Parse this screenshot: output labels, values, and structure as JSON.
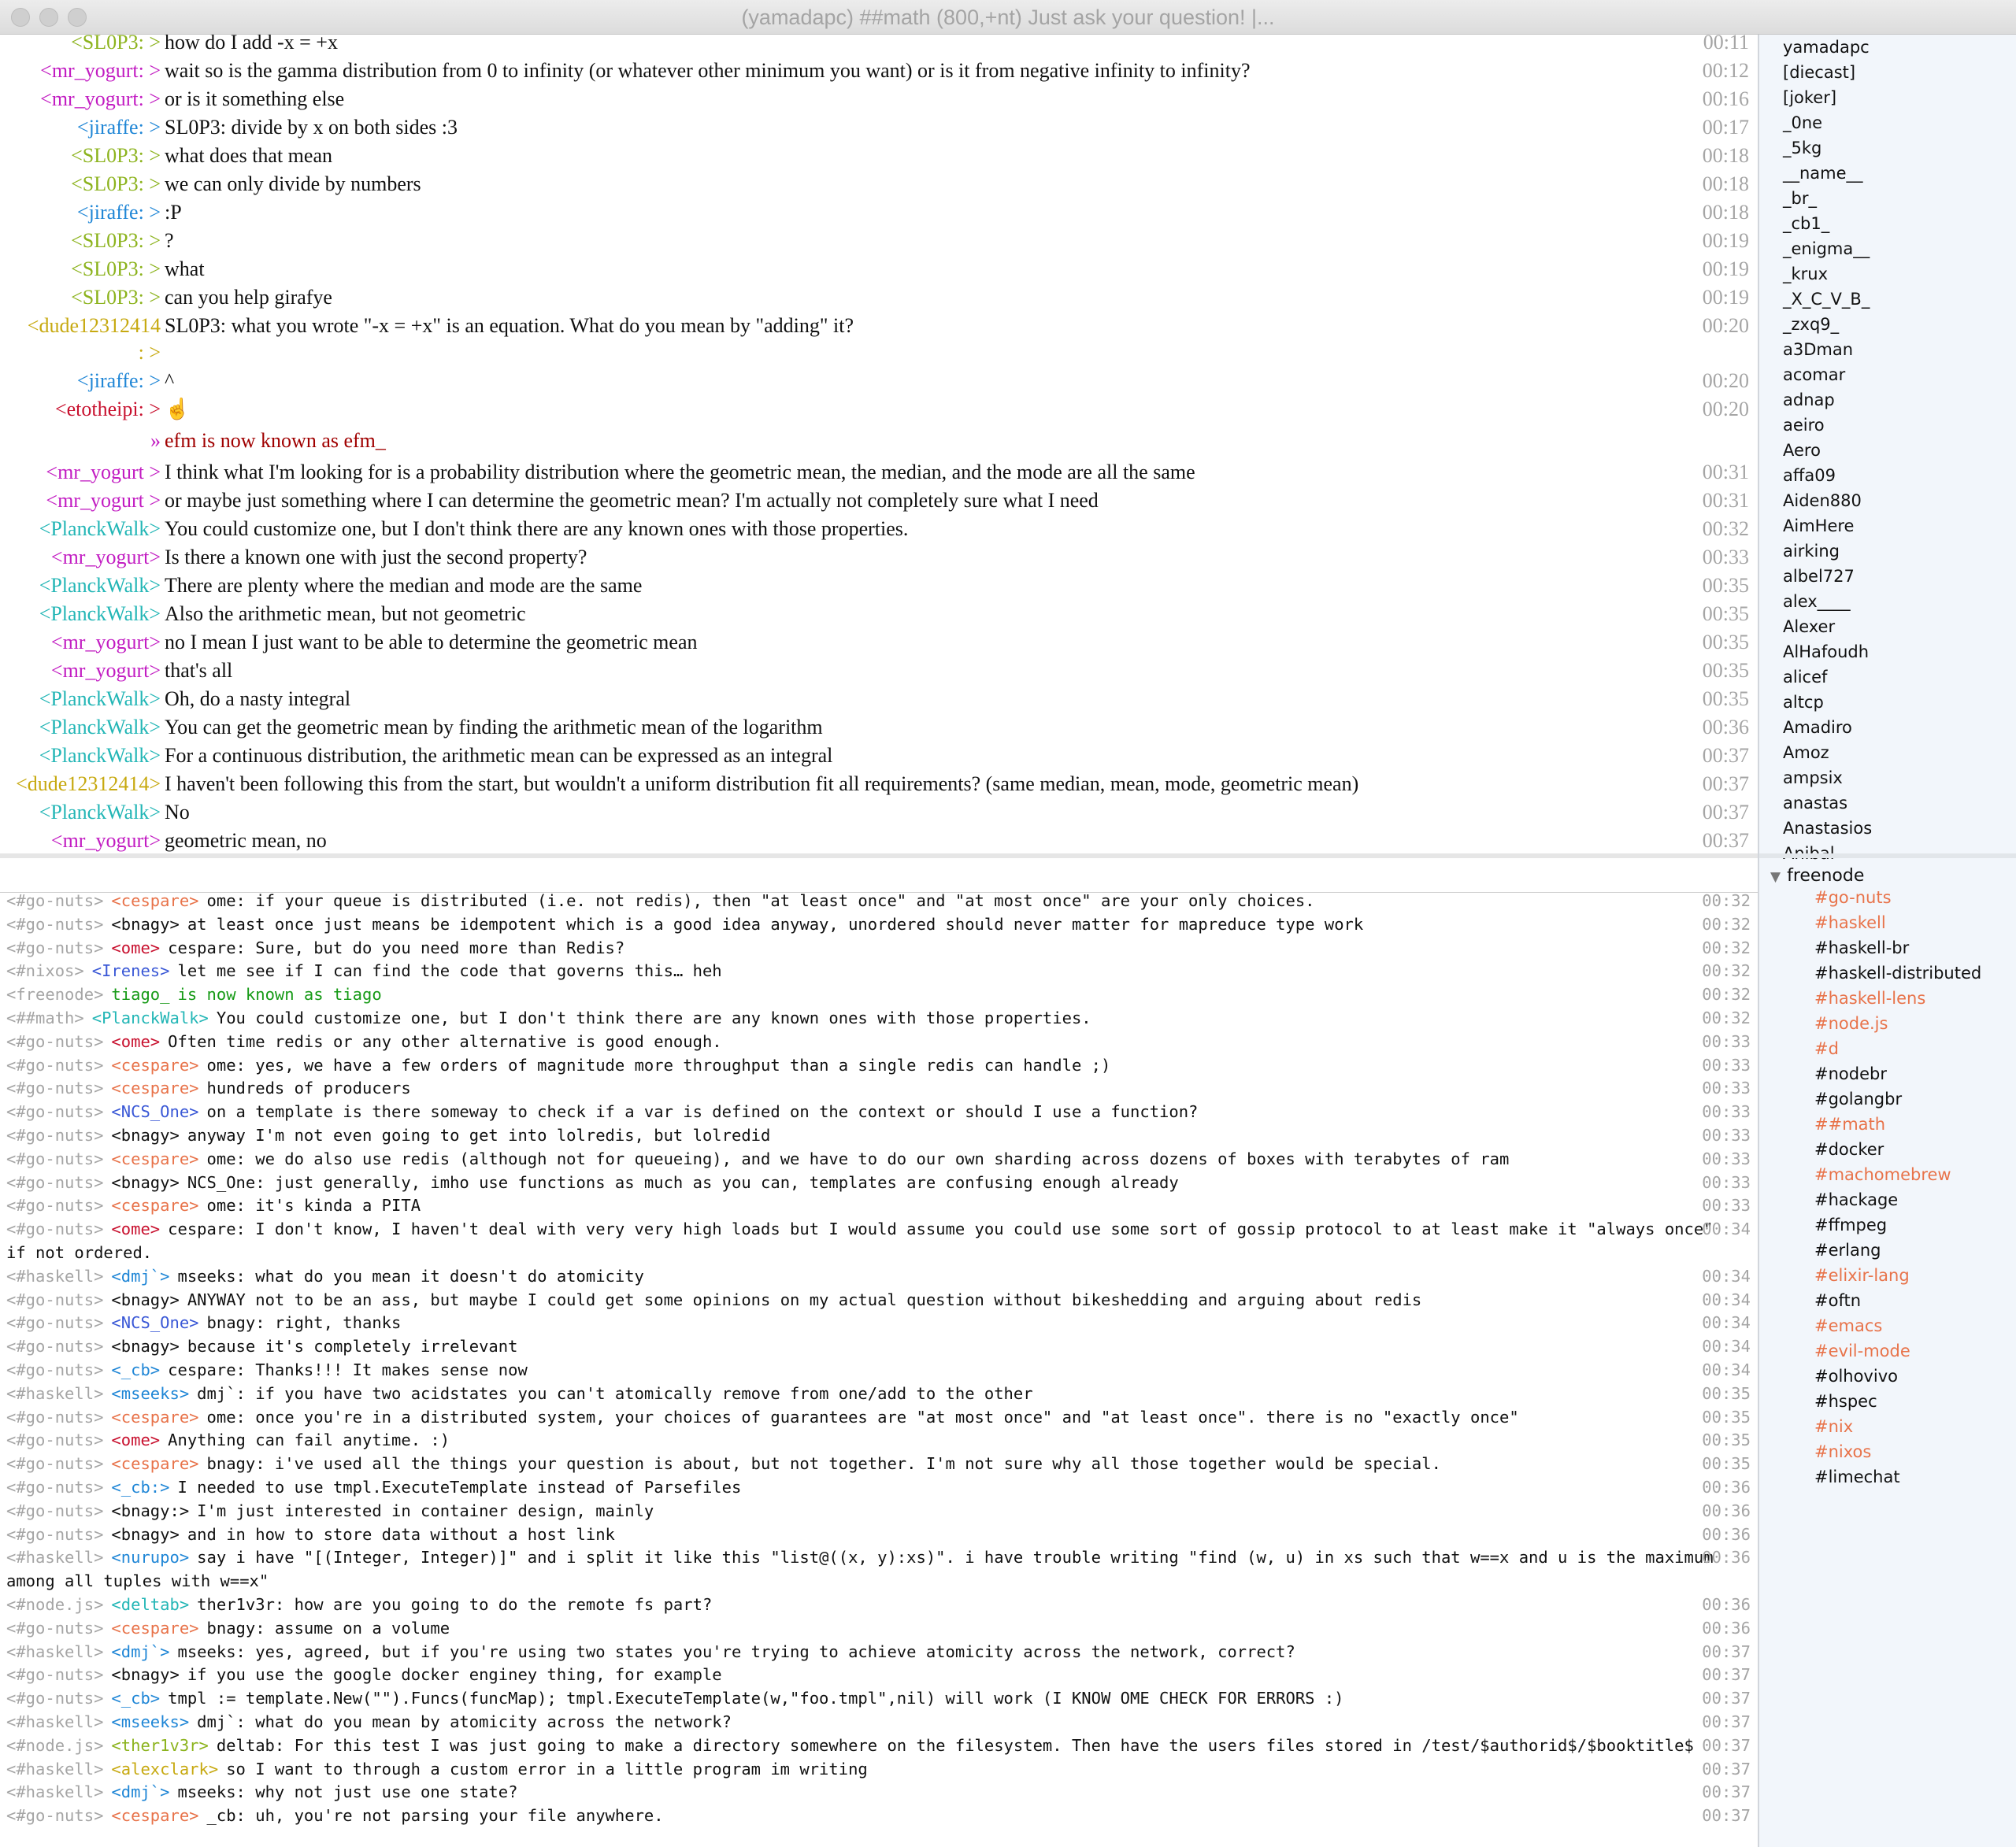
{
  "window": {
    "title": "(yamadapc) ##math (800,+nt) Just ask your question! |..."
  },
  "colors": {
    "green": "#8cb31d",
    "purple": "#c21cc2",
    "blue": "#1f86d6",
    "mustard": "#c7a910",
    "red": "#c8102e",
    "darkred": "#a00000",
    "teal": "#23b6b6",
    "gray": "#a5a5a5",
    "orange": "#e8734a",
    "navy": "#3a58d6",
    "grn": "#169a16"
  },
  "channel": {
    "messages": [
      {
        "nick": "<SL0P3: >",
        "color": "green",
        "text": "how do I add -x = +x",
        "time": "00:11"
      },
      {
        "nick": "<mr_yogurt: >",
        "color": "purple",
        "text": "wait so is the gamma distribution from 0 to infinity (or whatever other minimum you want) or is it from negative infinity to infinity?",
        "time": "00:12"
      },
      {
        "nick": "<mr_yogurt: >",
        "color": "purple",
        "text": "or is it something else",
        "time": "00:16"
      },
      {
        "nick": "<jiraffe: >",
        "color": "blue",
        "text": "SL0P3: divide by x on both sides :3",
        "time": "00:17"
      },
      {
        "nick": "<SL0P3: >",
        "color": "green",
        "text": "what does that mean",
        "time": "00:18"
      },
      {
        "nick": "<SL0P3: >",
        "color": "green",
        "text": "we can only divide by numbers",
        "time": "00:18"
      },
      {
        "nick": "<jiraffe: >",
        "color": "blue",
        "text": ":P",
        "time": "00:18"
      },
      {
        "nick": "<SL0P3: >",
        "color": "green",
        "text": "?",
        "time": "00:19"
      },
      {
        "nick": "<SL0P3: >",
        "color": "green",
        "text": "what",
        "time": "00:19"
      },
      {
        "nick": "<SL0P3: >",
        "color": "green",
        "text": "can you help girafye",
        "time": "00:19"
      },
      {
        "nick": "<dude12312414",
        "color": "mustard",
        "text": "SL0P3: what you wrote \"-x = +x\" is an equation. What do you mean by \"adding\" it?",
        "time": "00:20"
      },
      {
        "nick": ": >",
        "color": "mustard",
        "text": "",
        "time": ""
      },
      {
        "nick": "<jiraffe: >",
        "color": "blue",
        "text": "^",
        "time": "00:20"
      },
      {
        "nick": "<etotheipi: >",
        "color": "red",
        "text": "☝",
        "time": "00:20"
      },
      {
        "nick": "»",
        "color": "purple",
        "text": "efm is now known as efm_",
        "time": "",
        "tcolor": "darkred"
      },
      {
        "nick": "<mr_yogurt >",
        "color": "purple",
        "text": "I think what I'm looking for is a probability distribution where the geometric mean, the median, and the mode are all the same",
        "time": "00:31"
      },
      {
        "nick": "<mr_yogurt >",
        "color": "purple",
        "text": "or maybe just something where I can determine the geometric mean? I'm actually not completely sure what I need",
        "time": "00:31"
      },
      {
        "nick": "<PlanckWalk>",
        "color": "teal",
        "text": "You could customize one, but I don't think there are any known ones with those properties.",
        "time": "00:32"
      },
      {
        "nick": "<mr_yogurt>",
        "color": "purple",
        "text": "Is there a known one with just the second property?",
        "time": "00:33"
      },
      {
        "nick": "<PlanckWalk>",
        "color": "teal",
        "text": "There are plenty where the median and mode are the same",
        "time": "00:35"
      },
      {
        "nick": "<PlanckWalk>",
        "color": "teal",
        "text": "Also the arithmetic mean, but not geometric",
        "time": "00:35"
      },
      {
        "nick": "<mr_yogurt>",
        "color": "purple",
        "text": "no I mean I just want to be able to determine the geometric mean",
        "time": "00:35"
      },
      {
        "nick": "<mr_yogurt>",
        "color": "purple",
        "text": "that's all",
        "time": "00:35"
      },
      {
        "nick": "<PlanckWalk>",
        "color": "teal",
        "text": "Oh, do a nasty integral",
        "time": "00:35"
      },
      {
        "nick": "<PlanckWalk>",
        "color": "teal",
        "text": "You can get the geometric mean by finding the arithmetic mean of the logarithm",
        "time": "00:36"
      },
      {
        "nick": "<PlanckWalk>",
        "color": "teal",
        "text": "For a continuous distribution, the arithmetic mean can be expressed as an integral",
        "time": "00:37"
      },
      {
        "nick": "<dude12312414>",
        "color": "mustard",
        "text": "I haven't been following this from the start, but wouldn't a uniform distribution fit all requirements? (same median, mean, mode, geometric mean)",
        "time": "00:37"
      },
      {
        "nick": "<PlanckWalk>",
        "color": "teal",
        "text": "No",
        "time": "00:37"
      },
      {
        "nick": "<mr_yogurt>",
        "color": "purple",
        "text": "geometric mean, no",
        "time": "00:37"
      }
    ]
  },
  "log": {
    "lines": [
      {
        "channel": "<#go-nuts>",
        "nick": "<cespare>",
        "color": "orange",
        "text": "ome: if your queue is distributed (i.e. not redis), then \"at least once\" and \"at most once\" are your only choices.",
        "time": "00:32"
      },
      {
        "channel": "<#go-nuts>",
        "nick": "<bnagy>",
        "color": "",
        "text": "at least once just means be idempotent which is a good idea anyway, unordered should never matter for mapreduce type work",
        "time": "00:32"
      },
      {
        "channel": "<#go-nuts>",
        "nick": "<ome>",
        "color": "red",
        "text": "cespare: Sure, but do you need more than Redis?",
        "time": "00:32"
      },
      {
        "channel": "<#nixos>",
        "nick": "<Irenes>",
        "color": "navy",
        "text": "let me see if I can find the code that governs this… heh",
        "time": "00:32"
      },
      {
        "channel": "<freenode>",
        "nick": "tiago_",
        "color": "grn",
        "text": "is now known as tiago",
        "time": "00:32",
        "sys": true
      },
      {
        "channel": "<##math>",
        "nick": "<PlanckWalk>",
        "color": "teal",
        "text": "You could customize one, but I don't think there are any known ones with those properties.",
        "time": "00:32"
      },
      {
        "channel": "<#go-nuts>",
        "nick": "<ome>",
        "color": "red",
        "text": "Often time redis or any other alternative is good enough.",
        "time": "00:33"
      },
      {
        "channel": "<#go-nuts>",
        "nick": "<cespare>",
        "color": "orange",
        "text": "ome: yes, we have a few orders of magnitude more throughput than a single redis can handle ;)",
        "time": "00:33"
      },
      {
        "channel": "<#go-nuts>",
        "nick": "<cespare>",
        "color": "orange",
        "text": "hundreds of producers",
        "time": "00:33"
      },
      {
        "channel": "<#go-nuts>",
        "nick": "<NCS_One>",
        "color": "navy",
        "text": "on a template is there someway to check if a var is defined on the context or should I use a function?",
        "time": "00:33"
      },
      {
        "channel": "<#go-nuts>",
        "nick": "<bnagy>",
        "color": "",
        "text": "anyway I'm not even going to get into lolredis, but lolredid",
        "time": "00:33"
      },
      {
        "channel": "<#go-nuts>",
        "nick": "<cespare>",
        "color": "orange",
        "text": "ome: we do also use redis (although not for queueing), and we have to do our own sharding across dozens of boxes with terabytes of ram",
        "time": "00:33"
      },
      {
        "channel": "<#go-nuts>",
        "nick": "<bnagy>",
        "color": "",
        "text": "NCS_One: just generally, imho use functions as much as you can, templates are confusing enough already",
        "time": "00:33"
      },
      {
        "channel": "<#go-nuts>",
        "nick": "<cespare>",
        "color": "orange",
        "text": "ome: it's kinda a PITA",
        "time": "00:33"
      },
      {
        "channel": "<#go-nuts>",
        "nick": "<ome>",
        "color": "red",
        "text": "cespare: I don't know, I haven't deal with very very high loads but I would assume you could use some sort of gossip protocol to at least make it \"always once\"",
        "time": "00:34"
      },
      {
        "channel": "",
        "nick": "",
        "color": "",
        "text": "if not ordered.",
        "time": ""
      },
      {
        "channel": "<#haskell>",
        "nick": "<dmj`>",
        "color": "blue",
        "text": "mseeks: what do you mean it doesn't do atomicity",
        "time": "00:34"
      },
      {
        "channel": "<#go-nuts>",
        "nick": "<bnagy>",
        "color": "",
        "text": "ANYWAY not to be an ass, but maybe I could get some opinions on my actual question without bikeshedding and arguing about redis",
        "time": "00:34"
      },
      {
        "channel": "<#go-nuts>",
        "nick": "<NCS_One>",
        "color": "navy",
        "text": "bnagy: right, thanks",
        "time": "00:34"
      },
      {
        "channel": "<#go-nuts>",
        "nick": "<bnagy>",
        "color": "",
        "text": "because it's completely irrelevant",
        "time": "00:34"
      },
      {
        "channel": "<#go-nuts>",
        "nick": "<_cb>",
        "color": "blue",
        "text": "cespare: Thanks!!!  It makes sense now",
        "time": "00:34"
      },
      {
        "channel": "<#haskell>",
        "nick": "<mseeks>",
        "color": "blue",
        "text": "dmj`: if you have two acidstates you can't atomically remove from one/add to the other",
        "time": "00:35"
      },
      {
        "channel": "<#go-nuts>",
        "nick": "<cespare>",
        "color": "orange",
        "text": "ome: once you're in a distributed system, your choices of guarantees are \"at most once\" and \"at least once\". there is no \"exactly once\"",
        "time": "00:35"
      },
      {
        "channel": "<#go-nuts>",
        "nick": "<ome>",
        "color": "red",
        "text": "Anything can fail anytime. :)",
        "time": "00:35"
      },
      {
        "channel": "<#go-nuts>",
        "nick": "<cespare>",
        "color": "orange",
        "text": "bnagy: i've used all the things your question is about, but not together. I'm not sure why all those together would be special.",
        "time": "00:35"
      },
      {
        "channel": "<#go-nuts>",
        "nick": "<_cb:>",
        "color": "blue",
        "text": "I needed to use tmpl.ExecuteTemplate instead of Parsefiles",
        "time": "00:36"
      },
      {
        "channel": "<#go-nuts>",
        "nick": "<bnagy:>",
        "color": "",
        "text": "I'm just interested in container design, mainly",
        "time": "00:36"
      },
      {
        "channel": "<#go-nuts>",
        "nick": "<bnagy>",
        "color": "",
        "text": "and in how to store data without a host link",
        "time": "00:36"
      },
      {
        "channel": "<#haskell>",
        "nick": "<nurupo>",
        "color": "blue",
        "text": "say i have \"[(Integer, Integer)]\" and i split it like this \"list@((x, y):xs)\". i have trouble writing \"find (w, u) in xs such that w==x and u is the maximum",
        "time": "00:36"
      },
      {
        "channel": "",
        "nick": "",
        "color": "",
        "text": "among all tuples with w==x\"",
        "time": ""
      },
      {
        "channel": "<#node.js>",
        "nick": "<deltab>",
        "color": "teal",
        "text": "ther1v3r: how are you going to do the remote fs part?",
        "time": "00:36"
      },
      {
        "channel": "<#go-nuts>",
        "nick": "<cespare>",
        "color": "orange",
        "text": "bnagy: assume on a volume",
        "time": "00:36"
      },
      {
        "channel": "<#haskell>",
        "nick": "<dmj`>",
        "color": "blue",
        "text": "mseeks: yes, agreed, but if you're using two states you're trying to achieve atomicity across the network, correct?",
        "time": "00:37"
      },
      {
        "channel": "<#go-nuts>",
        "nick": "<bnagy>",
        "color": "",
        "text": "if you use the google docker enginey thing, for example",
        "time": "00:37"
      },
      {
        "channel": "<#go-nuts>",
        "nick": "<_cb>",
        "color": "blue",
        "text": "tmpl := template.New(\"\").Funcs(funcMap); tmpl.ExecuteTemplate(w,\"foo.tmpl\",nil)  will work (I KNOW OME CHECK FOR ERRORS :)",
        "time": "00:37"
      },
      {
        "channel": "<#haskell>",
        "nick": "<mseeks>",
        "color": "blue",
        "text": "dmj`: what do you mean by atomicity across the network?",
        "time": "00:37"
      },
      {
        "channel": "<#node.js>",
        "nick": "<ther1v3r>",
        "color": "green",
        "text": "deltab: For this test I was just going to make a directory somewhere on the filesystem. Then have the users files stored in /test/$authorid$/$booktitle$",
        "time": "00:37"
      },
      {
        "channel": "<#haskell>",
        "nick": "<alexclark>",
        "color": "mustard",
        "text": "so I want to through a custom error in a little program im writing",
        "time": "00:37"
      },
      {
        "channel": "<#haskell>",
        "nick": "<dmj`>",
        "color": "blue",
        "text": "mseeks: why not just use one state?",
        "time": "00:37"
      },
      {
        "channel": "<#go-nuts>",
        "nick": "<cespare>",
        "color": "orange",
        "text": "_cb: uh, you're not parsing your file anywhere.",
        "time": "00:37"
      }
    ]
  },
  "members": [
    "yamadapc",
    "[diecast]",
    "[joker]",
    "_0ne",
    "_5kg",
    "__name__",
    "_br_",
    "_cb1_",
    "_enigma__",
    "_krux",
    "_X_C_V_B_",
    "_zxq9_",
    "a3Dman",
    "acomar",
    "adnap",
    "aeiro",
    "Aero",
    "affa09",
    "Aiden880",
    "AimHere",
    "airking",
    "albel727",
    "alex____",
    "Alexer",
    "AlHafoudh",
    "alicef",
    "altcp",
    "Amadiro",
    "Amoz",
    "ampsix",
    "anastas",
    "Anastasios",
    "Anibal"
  ],
  "network": {
    "name": "freenode",
    "channels": [
      {
        "name": "#go-nuts",
        "active": true
      },
      {
        "name": "#haskell",
        "active": true
      },
      {
        "name": "#haskell-br",
        "active": false
      },
      {
        "name": "#haskell-distributed",
        "active": false
      },
      {
        "name": "#haskell-lens",
        "active": true
      },
      {
        "name": "#node.js",
        "active": true
      },
      {
        "name": "#d",
        "active": true
      },
      {
        "name": "#nodebr",
        "active": false
      },
      {
        "name": "#golangbr",
        "active": false
      },
      {
        "name": "##math",
        "active": true
      },
      {
        "name": "#docker",
        "active": false
      },
      {
        "name": "#machomebrew",
        "active": true
      },
      {
        "name": "#hackage",
        "active": false
      },
      {
        "name": "#ffmpeg",
        "active": false
      },
      {
        "name": "#erlang",
        "active": false
      },
      {
        "name": "#elixir-lang",
        "active": true
      },
      {
        "name": "#oftn",
        "active": false
      },
      {
        "name": "#emacs",
        "active": true
      },
      {
        "name": "#evil-mode",
        "active": true
      },
      {
        "name": "#olhovivo",
        "active": false
      },
      {
        "name": "#hspec",
        "active": false
      },
      {
        "name": "#nix",
        "active": true
      },
      {
        "name": "#nixos",
        "active": true
      },
      {
        "name": "#limechat",
        "active": false
      }
    ]
  },
  "icons": {
    "expand": "disclosure-triangle-icon",
    "emoji": "pointing-hand-icon"
  }
}
